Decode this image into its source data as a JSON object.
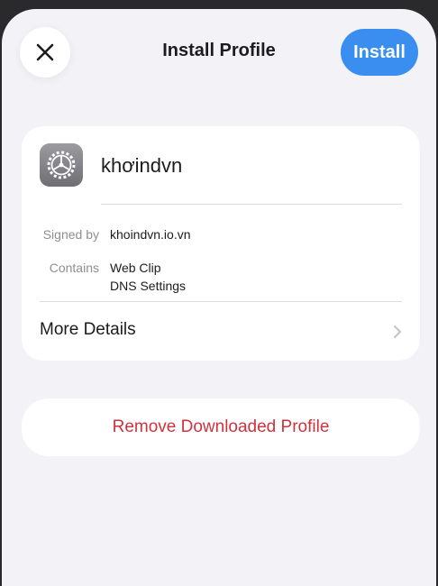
{
  "header": {
    "title": "Install Profile",
    "install_label": "Install"
  },
  "profile": {
    "name": "khơindvn",
    "signed_by_label": "Signed by",
    "signed_by_value": "khoindvn.io.vn",
    "contains_label": "Contains",
    "contains_items": [
      "Web Clip",
      "DNS Settings"
    ],
    "more_details_label": "More Details"
  },
  "actions": {
    "remove_label": "Remove Downloaded Profile"
  },
  "colors": {
    "accent": "#3a8ef0",
    "destructive": "#d0333d",
    "background": "#f2f2f7"
  },
  "icons": {
    "close": "close-icon",
    "profile": "settings-gear-icon",
    "chevron": "chevron-right-icon"
  }
}
